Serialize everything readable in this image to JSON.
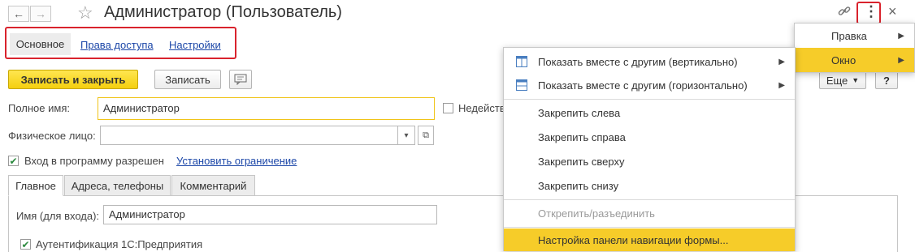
{
  "window": {
    "title": "Администратор (Пользователь)"
  },
  "panel_tabs": [
    "Основное",
    "Права доступа",
    "Настройки"
  ],
  "toolbar": {
    "save_close": "Записать и закрыть",
    "save": "Записать",
    "more": "Еще",
    "help": "?"
  },
  "fields": {
    "full_name_label": "Полное имя:",
    "full_name_value": "Администратор",
    "inactive_label": "Недейств",
    "person_label": "Физическое лицо:",
    "person_value": "",
    "login_allowed_label": "Вход в программу разрешен",
    "set_limit_link": "Установить ограничение"
  },
  "tabs": [
    "Главное",
    "Адреса, телефоны",
    "Комментарий"
  ],
  "main_tab": {
    "login_name_label": "Имя (для входа):",
    "login_name_value": "Администратор",
    "auth_label": "Аутентификация 1С:Предприятия"
  },
  "top_menu": [
    {
      "label": "Правка",
      "arrow": "▶"
    },
    {
      "label": "Окно",
      "arrow": "▶"
    }
  ],
  "window_submenu": [
    "Показать вместе с другим (вертикально)",
    "Показать вместе с другим (горизонтально)",
    "Закрепить слева",
    "Закрепить справа",
    "Закрепить сверху",
    "Закрепить снизу",
    "Открепить/разъединить",
    "Настройка панели навигации формы..."
  ],
  "icons": {
    "back": "←",
    "forward": "→",
    "star": "☆",
    "link": "🔗",
    "more": "⋮",
    "close": "×",
    "comment": "💬",
    "dropdown": "▾",
    "open": "⧉",
    "check": "✔"
  },
  "colors": {
    "accent": "#f6cc29",
    "highlight_frame": "#d9232d",
    "link": "#1c47a8"
  }
}
